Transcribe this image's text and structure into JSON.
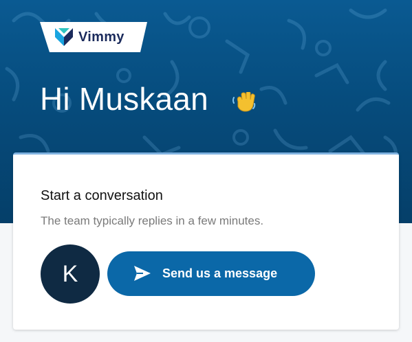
{
  "brand": {
    "name": "Vimmy",
    "logo_icon": "vimmy-logo-icon"
  },
  "header": {
    "greeting": "Hi Muskaan",
    "wave_icon": "waving-hand-emoji",
    "background_color": "#064c7d"
  },
  "card": {
    "title": "Start a conversation",
    "subtitle": "The team typically replies in a few minutes.",
    "avatar_initial": "K",
    "send_button_label": "Send us a message",
    "send_icon": "paper-plane-icon",
    "accent_color": "#0b68a8"
  }
}
